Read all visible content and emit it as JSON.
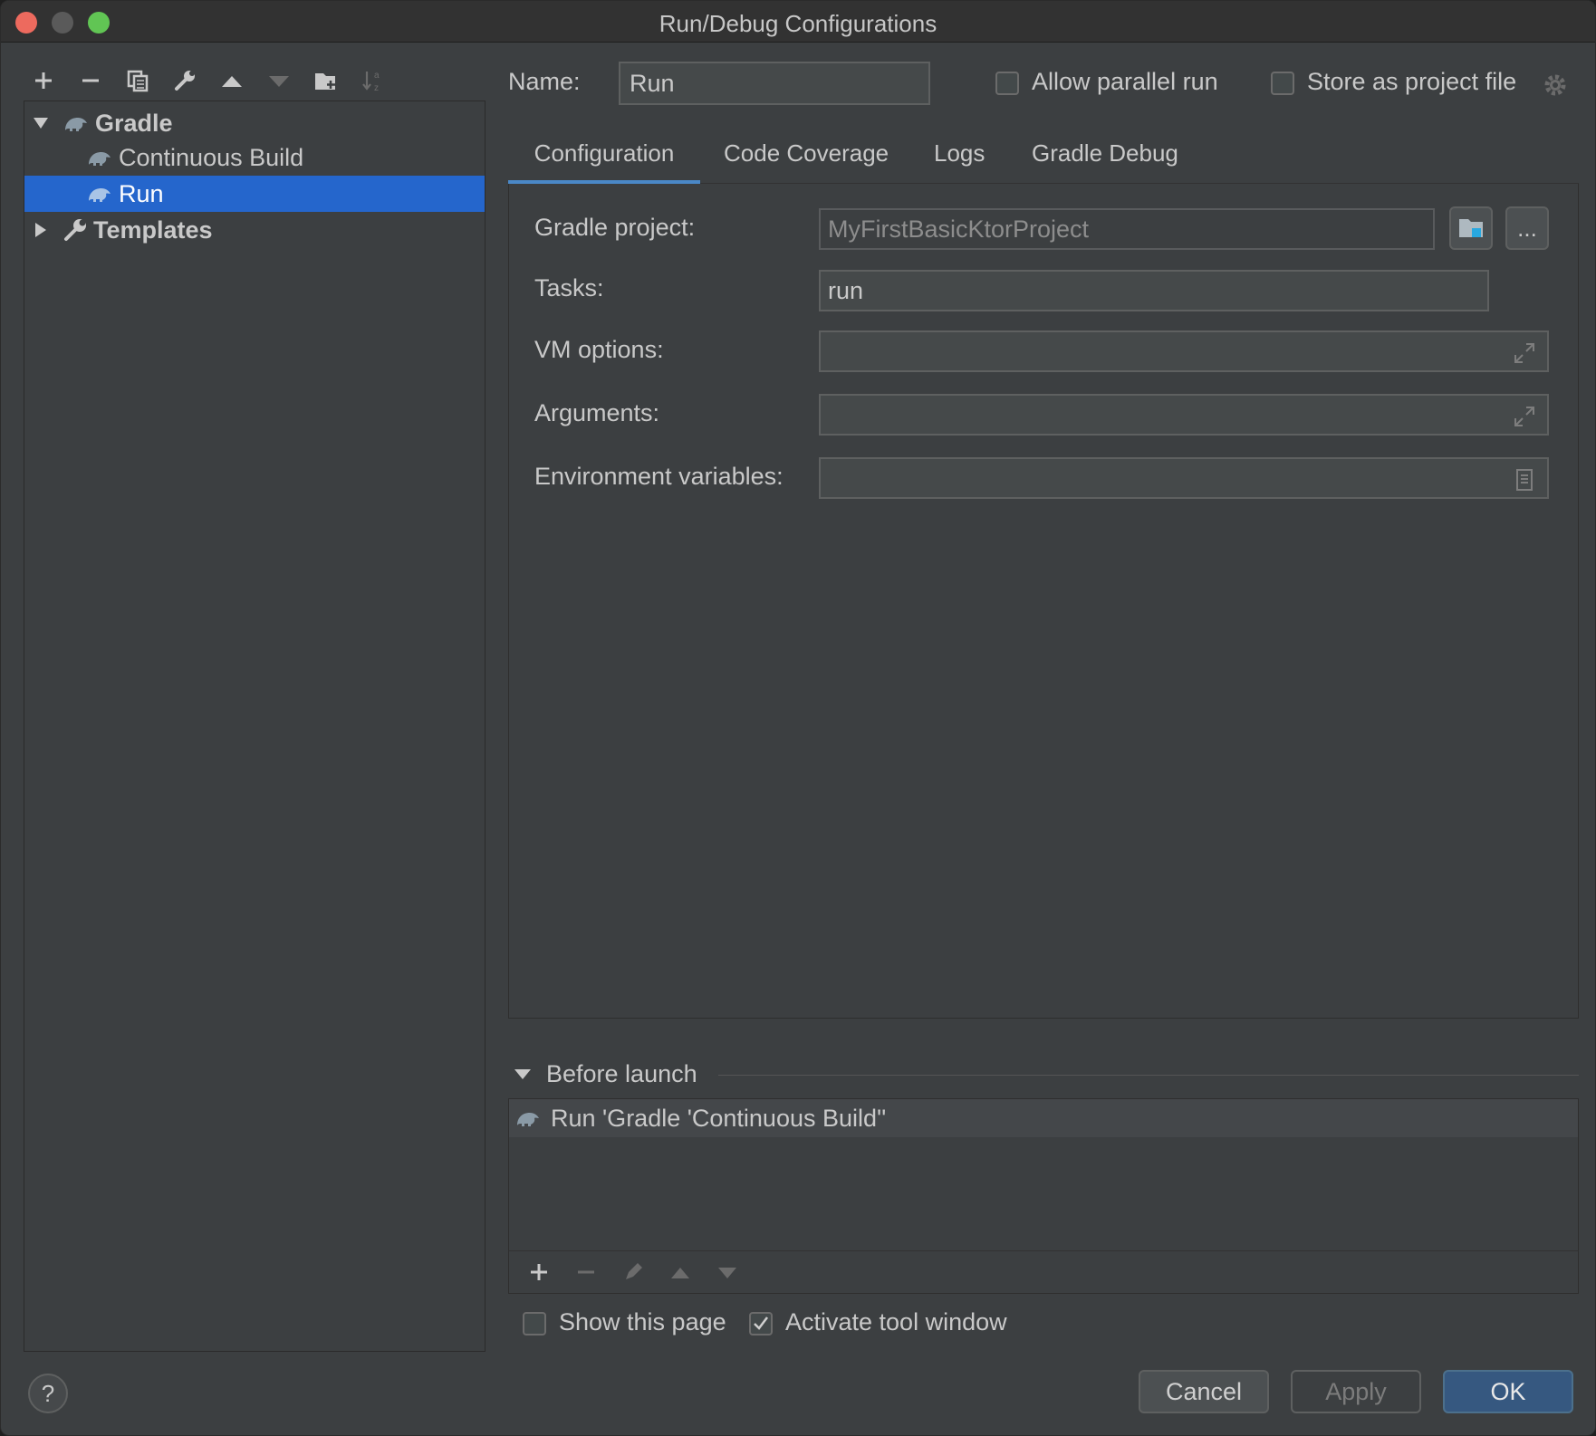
{
  "window": {
    "title": "Run/Debug Configurations"
  },
  "toolbar": {
    "icons": [
      "add-icon",
      "remove-icon",
      "copy-icon",
      "wrench-icon",
      "move-up-icon",
      "move-down-icon",
      "new-folder-icon",
      "sort-icon"
    ]
  },
  "tree": {
    "gradle": "Gradle",
    "continuous_build": "Continuous Build",
    "run": "Run",
    "templates": "Templates"
  },
  "header": {
    "name_label": "Name:",
    "name_value": "Run",
    "allow_parallel_label": "Allow parallel run",
    "allow_parallel_checked": false,
    "store_project_label": "Store as project file",
    "store_project_checked": false
  },
  "tabs": [
    "Configuration",
    "Code Coverage",
    "Logs",
    "Gradle Debug"
  ],
  "active_tab": "Configuration",
  "form": {
    "gradle_project_label": "Gradle project:",
    "gradle_project_value": "MyFirstBasicKtorProject",
    "browse_button": "...",
    "tasks_label": "Tasks:",
    "tasks_value": "run",
    "vm_options_label": "VM options:",
    "vm_options_value": "",
    "arguments_label": "Arguments:",
    "arguments_value": "",
    "env_label": "Environment variables:",
    "env_value": ""
  },
  "before_launch": {
    "title": "Before launch",
    "items": [
      "Run 'Gradle 'Continuous Build''"
    ]
  },
  "options": {
    "show_page_label": "Show this page",
    "show_page_checked": false,
    "activate_tool_label": "Activate tool window",
    "activate_tool_checked": true
  },
  "buttons": {
    "help": "?",
    "cancel": "Cancel",
    "apply": "Apply",
    "ok": "OK"
  },
  "colors": {
    "selection": "#2566cc",
    "ok_button": "#365880",
    "tab_underline": "#4a88c7"
  }
}
